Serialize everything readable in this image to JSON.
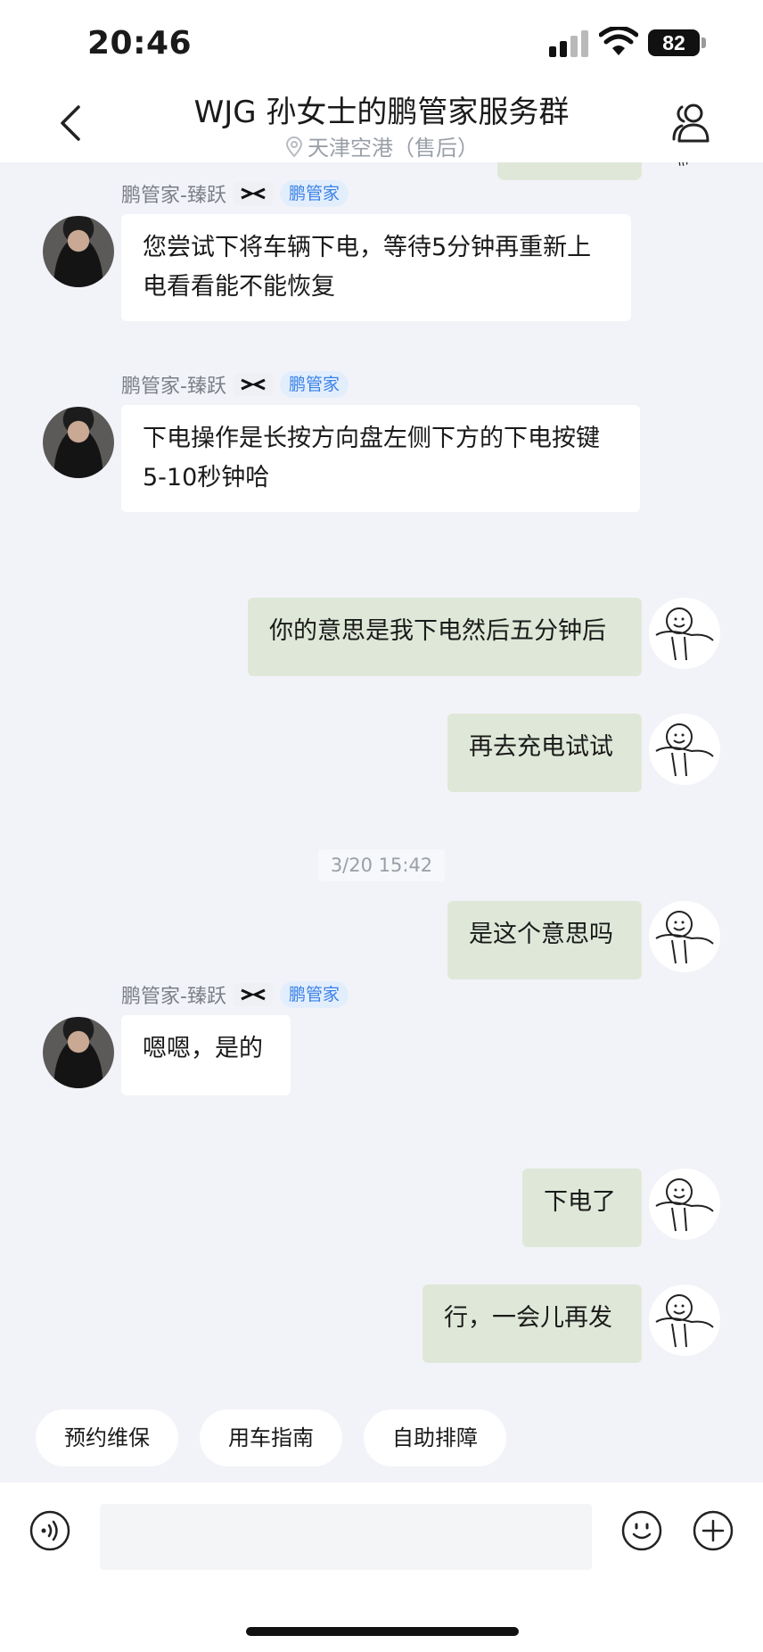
{
  "status_bar": {
    "time": "20:46",
    "battery": "82"
  },
  "header": {
    "title": "WJG 孙女士的鹏管家服务群",
    "subtitle": "天津空港（售后）"
  },
  "messages": [
    {
      "sender": "鹏管家-臻跃",
      "badge": "鹏管家",
      "text": "您尝试下将车辆下电，等待5分钟再重新上\n电看看能不能恢复"
    },
    {
      "sender": "鹏管家-臻跃",
      "badge": "鹏管家",
      "text": "下电操作是长按方向盘左侧下方的下电按键\n5-10秒钟哈"
    },
    {
      "text": "你的意思是我下电然后五分钟后"
    },
    {
      "text": "再去充电试试"
    },
    {
      "timestamp": "3/20 15:42"
    },
    {
      "text": "是这个意思吗"
    },
    {
      "sender": "鹏管家-臻跃",
      "badge": "鹏管家",
      "text": "嗯嗯，是的"
    },
    {
      "text": "下电了"
    },
    {
      "text": "行，一会儿再发"
    }
  ],
  "quick_replies": [
    "预约维保",
    "用车指南",
    "自助排障"
  ],
  "input": {
    "placeholder": ""
  },
  "colors": {
    "outgoing_bubble": "#dfe8d8",
    "badge_text": "#3a82e8",
    "background": "#f2f3f8"
  }
}
